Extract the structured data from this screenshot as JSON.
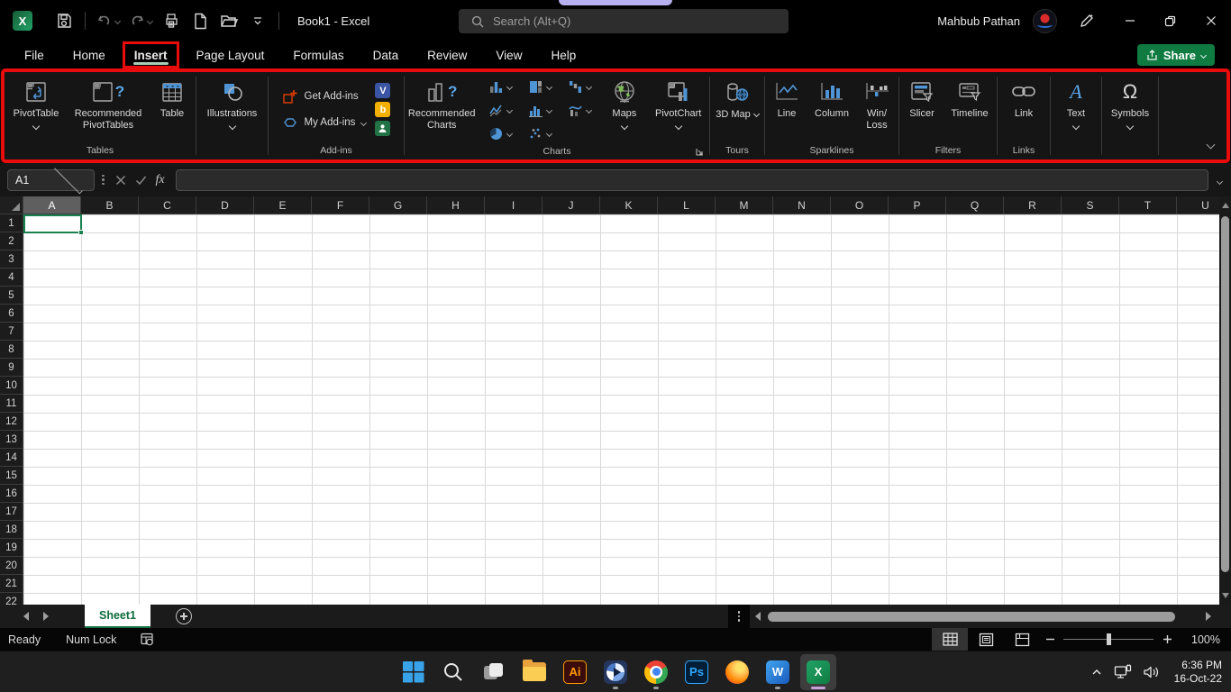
{
  "colors": {
    "excel_green": "#107c41",
    "annotation_red": "#e80c0c",
    "selection_green": "#1a7f4e",
    "taskbar_active_underline": "#c9a0dc"
  },
  "titlebar": {
    "doc_title": "Book1 - Excel",
    "search_placeholder": "Search (Alt+Q)",
    "user_name": "Mahbub Pathan"
  },
  "menu": {
    "tabs": [
      "File",
      "Home",
      "Insert",
      "Page Layout",
      "Formulas",
      "Data",
      "Review",
      "View",
      "Help"
    ],
    "active_tab": "Insert",
    "share_label": "Share"
  },
  "ribbon": {
    "groups": {
      "tables": {
        "label": "Tables",
        "pivot_table": "PivotTable",
        "recommended_pivottables": "Recommended PivotTables",
        "table": "Table"
      },
      "illustrations": {
        "button": "Illustrations"
      },
      "addins": {
        "label": "Add-ins",
        "get_addins": "Get Add-ins",
        "my_addins": "My Add-ins",
        "app_glyphs": {
          "visio": "V",
          "bing": "b"
        }
      },
      "charts": {
        "label": "Charts",
        "recommended_charts": "Recommended Charts",
        "question_mark": "?",
        "maps": "Maps",
        "pivot_chart": "PivotChart"
      },
      "tours": {
        "label": "Tours",
        "map_3d": "3D Map"
      },
      "sparklines": {
        "label": "Sparklines",
        "line": "Line",
        "column": "Column",
        "win_loss": "Win/ Loss"
      },
      "filters": {
        "label": "Filters",
        "slicer": "Slicer",
        "timeline": "Timeline"
      },
      "links": {
        "label": "Links",
        "link": "Link"
      },
      "text": {
        "button": "Text",
        "icon_glyph": "A"
      },
      "symbols": {
        "button": "Symbols",
        "icon_glyph": "Ω"
      }
    }
  },
  "formula_bar": {
    "name_box": "A1",
    "fx_label": "fx",
    "formula_value": ""
  },
  "grid": {
    "column_letters": [
      "A",
      "B",
      "C",
      "D",
      "E",
      "F",
      "G",
      "H",
      "I",
      "J",
      "K",
      "L",
      "M",
      "N",
      "O",
      "P",
      "Q",
      "R",
      "S",
      "T",
      "U"
    ],
    "row_numbers": [
      1,
      2,
      3,
      4,
      5,
      6,
      7,
      8,
      9,
      10,
      11,
      12,
      13,
      14,
      15,
      16,
      17,
      18,
      19,
      20,
      21,
      22
    ],
    "selected_cell": "A1",
    "selected_column": "A"
  },
  "sheet_tabs": {
    "active": "Sheet1"
  },
  "status_bar": {
    "ready": "Ready",
    "num_lock": "Num Lock",
    "zoom_pct": "100%"
  },
  "taskbar": {
    "glyphs": {
      "illustrator": "Ai",
      "photoshop": "Ps",
      "word": "W",
      "excel": "X",
      "excel_logo": "X"
    },
    "tray": {
      "time": "6:36 PM",
      "date": "16-Oct-22"
    }
  }
}
